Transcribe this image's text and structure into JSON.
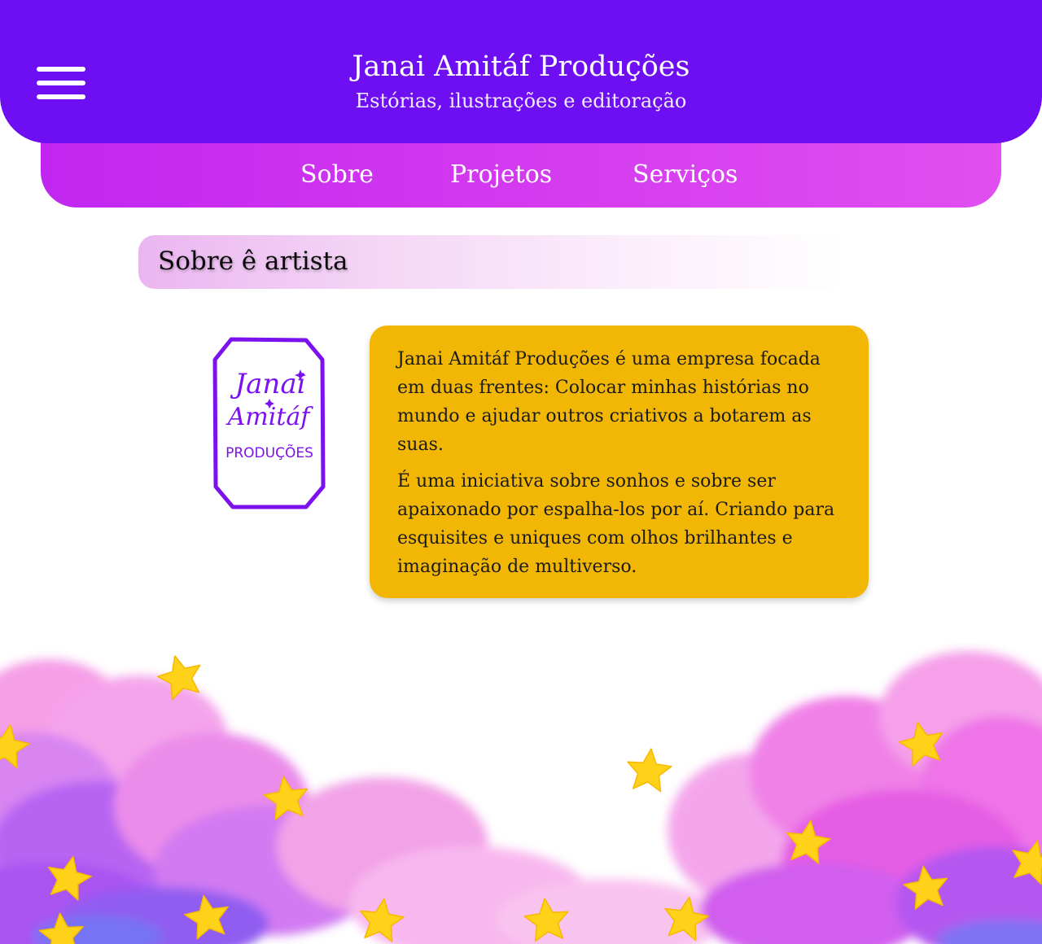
{
  "header": {
    "title": "Janai Amitáf Produções",
    "subtitle": "Estórias, ilustrações e editoração",
    "menu_icon": "hamburger-menu-icon",
    "background_color": "#6e0ef3"
  },
  "nav": {
    "items": [
      {
        "label": "Sobre"
      },
      {
        "label": "Projetos"
      },
      {
        "label": "Serviços"
      }
    ],
    "background_color": "#c126f0"
  },
  "about": {
    "heading": "Sobre ê artista",
    "logo": {
      "line1": "Janai",
      "line2": "Amitáf",
      "line3": "PRODUÇÕES",
      "color": "#7b12ee"
    },
    "paragraphs": [
      "Janai Amitáf Produções é uma empresa focada em duas frentes: Colocar minhas histórias no mundo e ajudar outros criativos a botarem as suas.",
      "É uma iniciativa sobre sonhos e sobre ser apaixonado por espalha-los por aí. Criando para esquisites e uniques com olhos brilhantes e imaginação de multiverso."
    ],
    "card_color": "#f2b705"
  },
  "decoration": {
    "type": "watercolor-clouds-with-stars",
    "star_color": "#ffd21a"
  }
}
